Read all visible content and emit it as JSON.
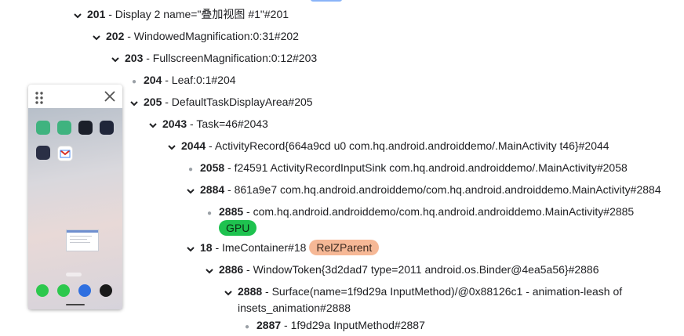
{
  "tree": {
    "n201": {
      "id": "201",
      "text": " - Display 2 name=\"叠加视图 #1\"#201"
    },
    "n202": {
      "id": "202",
      "text": " - WindowedMagnification:0:31#202"
    },
    "n203": {
      "id": "203",
      "text": " - FullscreenMagnification:0:12#203"
    },
    "n204": {
      "id": "204",
      "text": " - Leaf:0:1#204"
    },
    "n205": {
      "id": "205",
      "text": " - DefaultTaskDisplayArea#205"
    },
    "n2043": {
      "id": "2043",
      "text": " - Task=46#2043"
    },
    "n2044": {
      "id": "2044",
      "text": " - ActivityRecord{664a9cd u0 com.hq.android.androiddemo/.MainActivity t46}#2044"
    },
    "n2058": {
      "id": "2058",
      "text": " - f24591 ActivityRecordInputSink com.hq.android.androiddemo/.MainActivity#2058"
    },
    "n2884": {
      "id": "2884",
      "text": " - 861a9e7 com.hq.android.androiddemo/com.hq.android.androiddemo.MainActivity#2884"
    },
    "n2885": {
      "id": "2885",
      "text": " - com.hq.android.androiddemo/com.hq.android.androiddemo.MainActivity#2885",
      "tag": "GPU"
    },
    "n18": {
      "id": "18",
      "text": " - ImeContainer#18",
      "tag": "RelZParent"
    },
    "n2886": {
      "id": "2886",
      "text": " - WindowToken{3d2dad7 type=2011 android.os.Binder@4ea5a56}#2886"
    },
    "n2888": {
      "id": "2888",
      "text": " - Surface(name=1f9d29a InputMethod)/@0x88126c1 - animation-leash of",
      "text2": "insets_animation#2888"
    },
    "n2887": {
      "id": "2887",
      "text": " - 1f9d29a InputMethod#2887"
    }
  },
  "preview": {
    "apps": [
      {
        "label": "",
        "color": "#3fb37f"
      },
      {
        "label": "",
        "color": "#3fb37f"
      },
      {
        "label": "",
        "color": "#1b1f2a"
      },
      {
        "label": "",
        "color": "#20263a"
      },
      {
        "label": "",
        "color": "#2a2f45"
      },
      {
        "label": "",
        "color": "#ffffff"
      }
    ],
    "dock": [
      {
        "color": "#2dc84d"
      },
      {
        "color": "#2dc84d"
      },
      {
        "color": "#2f6fe0"
      },
      {
        "color": "#1a1a1a"
      }
    ]
  },
  "colors": {
    "gpu_tag": "#1ec24f",
    "relz_tag": "#f6b896"
  }
}
